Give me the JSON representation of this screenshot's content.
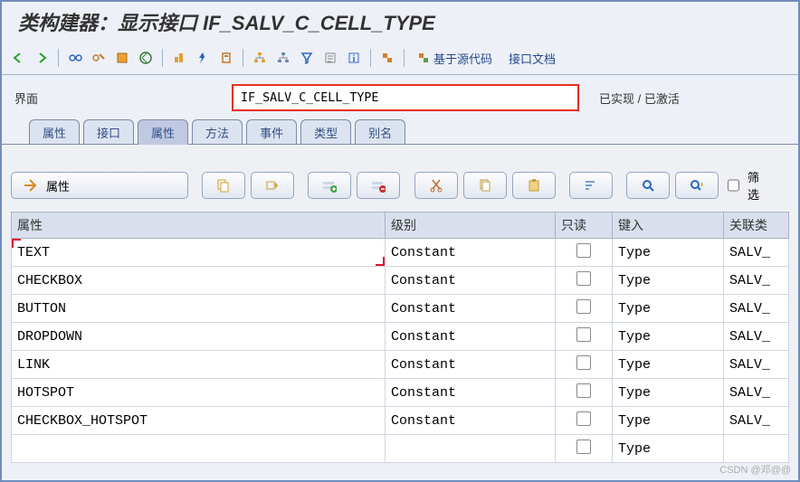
{
  "title": "类构建器：显示接口 IF_SALV_C_CELL_TYPE",
  "toolbar": {
    "source_based": "基于源代码",
    "interface_doc": "接口文档"
  },
  "field": {
    "label": "界面",
    "value": "IF_SALV_C_CELL_TYPE",
    "status": "已实现 / 已激活"
  },
  "tabs": [
    "属性",
    "接口",
    "属性",
    "方法",
    "事件",
    "类型",
    "别名"
  ],
  "active_tab": 2,
  "btnbar": {
    "main": "属性",
    "filter": "筛选"
  },
  "columns": {
    "attr": "属性",
    "level": "级别",
    "readonly": "只读",
    "type": "键入",
    "assoc": "关联类"
  },
  "rows": [
    {
      "attr": "TEXT",
      "level": "Constant",
      "readonly": false,
      "type": "Type",
      "assoc": "SALV_"
    },
    {
      "attr": "CHECKBOX",
      "level": "Constant",
      "readonly": false,
      "type": "Type",
      "assoc": "SALV_"
    },
    {
      "attr": "BUTTON",
      "level": "Constant",
      "readonly": false,
      "type": "Type",
      "assoc": "SALV_"
    },
    {
      "attr": "DROPDOWN",
      "level": "Constant",
      "readonly": false,
      "type": "Type",
      "assoc": "SALV_"
    },
    {
      "attr": "LINK",
      "level": "Constant",
      "readonly": false,
      "type": "Type",
      "assoc": "SALV_"
    },
    {
      "attr": "HOTSPOT",
      "level": "Constant",
      "readonly": false,
      "type": "Type",
      "assoc": "SALV_"
    },
    {
      "attr": "CHECKBOX_HOTSPOT",
      "level": "Constant",
      "readonly": false,
      "type": "Type",
      "assoc": "SALV_"
    },
    {
      "attr": "",
      "level": "",
      "readonly": false,
      "type": "Type",
      "assoc": ""
    }
  ],
  "watermark": "CSDN @邓@@"
}
